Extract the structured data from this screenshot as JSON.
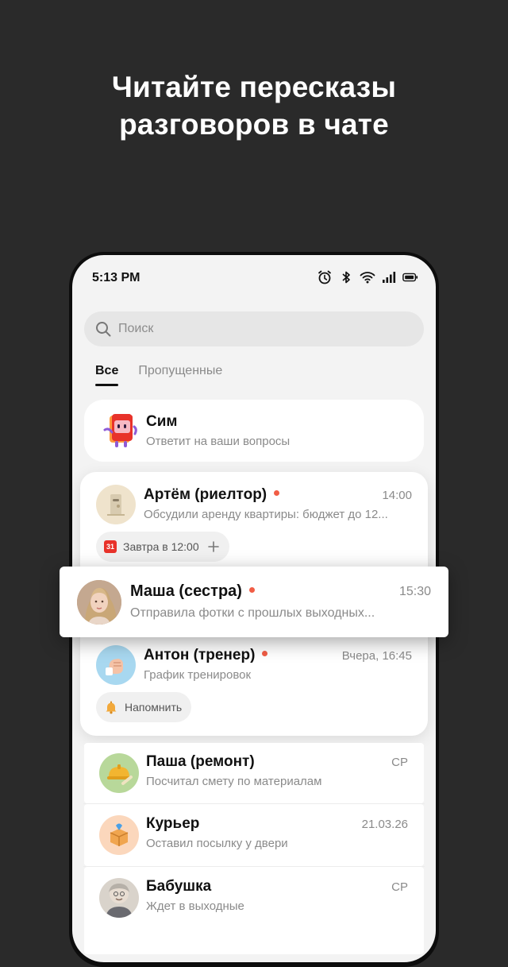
{
  "headline": {
    "line1": "Читайте пересказы",
    "line2": "разговоров в чате"
  },
  "status_bar": {
    "time": "5:13 PM",
    "icons": [
      "alarm-icon",
      "bluetooth-icon",
      "wifi-icon",
      "signal-icon",
      "battery-icon"
    ]
  },
  "search": {
    "placeholder": "Поиск"
  },
  "tabs": [
    {
      "label": "Все",
      "active": true
    },
    {
      "label": "Пропущенные",
      "active": false
    }
  ],
  "assistant": {
    "name": "Сим",
    "subtitle": "Ответит на ваши вопросы"
  },
  "chats": [
    {
      "name": "Артём (риелтор)",
      "unread": true,
      "preview": "Обсудили аренду квартиры: бюджет до 12...",
      "time": "14:00",
      "chip": {
        "icon": "calendar-icon",
        "calendar_day": "31",
        "label": "Завтра в 12:00"
      }
    },
    {
      "name": "Маша (сестра)",
      "unread": true,
      "preview": "Отправила фотки с прошлых выходных...",
      "time": "15:30"
    },
    {
      "name": "Антон (тренер)",
      "unread": true,
      "preview": "График тренировок",
      "time": "Вчера, 16:45",
      "chip": {
        "icon": "bell-icon",
        "label": "Напомнить"
      }
    },
    {
      "name": "Паша (ремонт)",
      "unread": false,
      "preview": "Посчитал смету по материалам",
      "time": "СР"
    },
    {
      "name": "Курьер",
      "unread": false,
      "preview": "Оставил посылку у двери",
      "time": "21.03.26"
    },
    {
      "name": "Бабушка",
      "unread": false,
      "preview": "Ждет в выходные",
      "time": "СР"
    }
  ],
  "colors": {
    "background": "#2a2a2a",
    "screen": "#f3f3f3",
    "unread_dot": "#f15d45",
    "accent_red": "#e8322a"
  }
}
